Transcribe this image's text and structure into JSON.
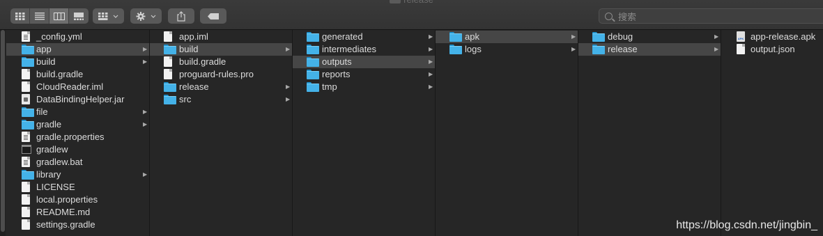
{
  "window": {
    "title": "release"
  },
  "toolbar": {
    "view_icons": [
      "icon-view-icon",
      "list-view-icon",
      "column-view-icon",
      "gallery-view-icon"
    ],
    "active_view": 2,
    "share_icon": "share-icon",
    "tag_icon": "tag-icon"
  },
  "search": {
    "placeholder": "搜索"
  },
  "columns": [
    {
      "items": [
        {
          "name": "_config.yml",
          "icon": "file-lines",
          "arrow": false,
          "selected": false
        },
        {
          "name": "app",
          "icon": "folder",
          "arrow": true,
          "selected": true
        },
        {
          "name": "build",
          "icon": "folder",
          "arrow": true,
          "selected": false
        },
        {
          "name": "build.gradle",
          "icon": "file",
          "arrow": false,
          "selected": false
        },
        {
          "name": "CloudReader.iml",
          "icon": "file",
          "arrow": false,
          "selected": false
        },
        {
          "name": "DataBindingHelper.jar",
          "icon": "jar",
          "arrow": false,
          "selected": false
        },
        {
          "name": "file",
          "icon": "folder",
          "arrow": true,
          "selected": false
        },
        {
          "name": "gradle",
          "icon": "folder",
          "arrow": true,
          "selected": false
        },
        {
          "name": "gradle.properties",
          "icon": "file-lines",
          "arrow": false,
          "selected": false
        },
        {
          "name": "gradlew",
          "icon": "terminal",
          "arrow": false,
          "selected": false
        },
        {
          "name": "gradlew.bat",
          "icon": "file-lines",
          "arrow": false,
          "selected": false
        },
        {
          "name": "library",
          "icon": "folder",
          "arrow": true,
          "selected": false
        },
        {
          "name": "LICENSE",
          "icon": "file",
          "arrow": false,
          "selected": false
        },
        {
          "name": "local.properties",
          "icon": "file",
          "arrow": false,
          "selected": false
        },
        {
          "name": "README.md",
          "icon": "file",
          "arrow": false,
          "selected": false
        },
        {
          "name": "settings.gradle",
          "icon": "file",
          "arrow": false,
          "selected": false
        }
      ]
    },
    {
      "items": [
        {
          "name": "app.iml",
          "icon": "file",
          "arrow": false,
          "selected": false
        },
        {
          "name": "build",
          "icon": "folder",
          "arrow": true,
          "selected": true
        },
        {
          "name": "build.gradle",
          "icon": "file",
          "arrow": false,
          "selected": false
        },
        {
          "name": "proguard-rules.pro",
          "icon": "file",
          "arrow": false,
          "selected": false
        },
        {
          "name": "release",
          "icon": "folder",
          "arrow": true,
          "selected": false
        },
        {
          "name": "src",
          "icon": "folder",
          "arrow": true,
          "selected": false
        }
      ]
    },
    {
      "items": [
        {
          "name": "generated",
          "icon": "folder",
          "arrow": true,
          "selected": false
        },
        {
          "name": "intermediates",
          "icon": "folder",
          "arrow": true,
          "selected": false
        },
        {
          "name": "outputs",
          "icon": "folder",
          "arrow": true,
          "selected": true
        },
        {
          "name": "reports",
          "icon": "folder",
          "arrow": true,
          "selected": false
        },
        {
          "name": "tmp",
          "icon": "folder",
          "arrow": true,
          "selected": false
        }
      ]
    },
    {
      "items": [
        {
          "name": "apk",
          "icon": "folder",
          "arrow": true,
          "selected": true
        },
        {
          "name": "logs",
          "icon": "folder",
          "arrow": true,
          "selected": false
        }
      ]
    },
    {
      "items": [
        {
          "name": "debug",
          "icon": "folder",
          "arrow": true,
          "selected": false
        },
        {
          "name": "release",
          "icon": "folder",
          "arrow": true,
          "selected": true
        }
      ]
    },
    {
      "items": [
        {
          "name": "app-release.apk",
          "icon": "apk",
          "arrow": false,
          "selected": false
        },
        {
          "name": "output.json",
          "icon": "file",
          "arrow": false,
          "selected": false
        }
      ]
    }
  ],
  "watermark": "https://blog.csdn.net/jingbin_"
}
